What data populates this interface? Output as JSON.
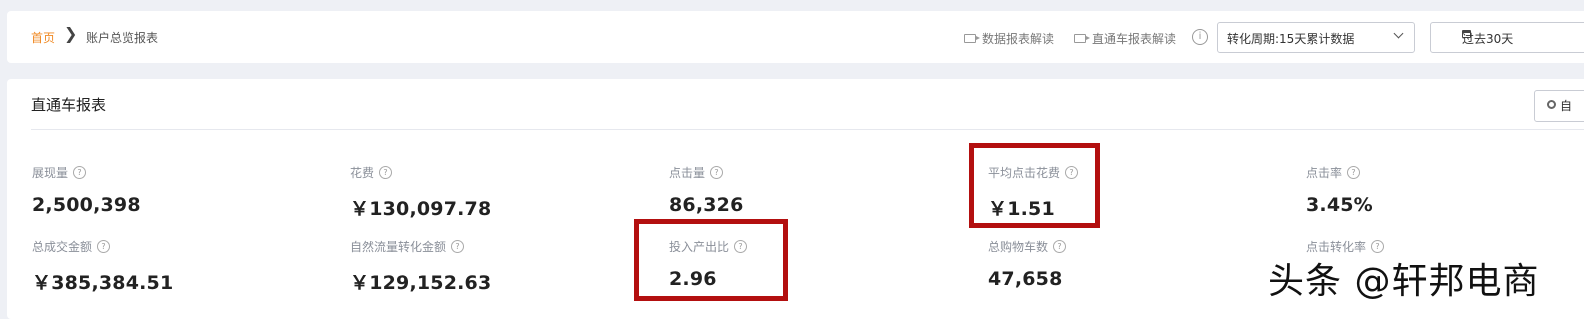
{
  "breadcrumb": {
    "home": "首页",
    "separator": "❯",
    "current": "账户总览报表"
  },
  "toolbar": {
    "data_report_link": "数据报表解读",
    "ztc_report_link": "直通车报表解读",
    "info_icon": "info-icon",
    "period_select": "转化周期:15天累计数据",
    "date_range": "过去30天"
  },
  "card": {
    "title": "直通车报表",
    "settings_button": "自"
  },
  "metrics": [
    {
      "label": "展现量",
      "value": "2,500,398"
    },
    {
      "label": "花费",
      "value": "￥130,097.78"
    },
    {
      "label": "点击量",
      "value": "86,326"
    },
    {
      "label": "平均点击花费",
      "value": "￥1.51"
    },
    {
      "label": "点击率",
      "value": "3.45%"
    },
    {
      "label": "总成交金额",
      "value": "￥385,384.51"
    },
    {
      "label": "自然流量转化金额",
      "value": "￥129,152.63"
    },
    {
      "label": "投入产出比",
      "value": "2.96"
    },
    {
      "label": "总购物车数",
      "value": "47,658"
    },
    {
      "label": "点击转化率",
      "value": ""
    }
  ],
  "highlight_color": "#b30f0f",
  "watermark": "头条 @轩邦电商"
}
